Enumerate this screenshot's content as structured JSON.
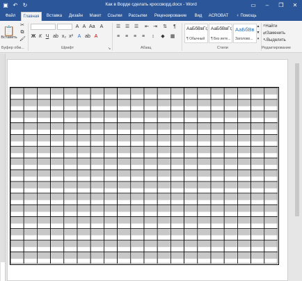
{
  "window": {
    "title": "Как в Ворде сделать кроссворд.docx - Word"
  },
  "tabs": [
    {
      "label": "Файл"
    },
    {
      "label": "Главная"
    },
    {
      "label": "Вставка"
    },
    {
      "label": "Дизайн"
    },
    {
      "label": "Макет"
    },
    {
      "label": "Ссылки"
    },
    {
      "label": "Рассылки"
    },
    {
      "label": "Рецензирование"
    },
    {
      "label": "Вид"
    },
    {
      "label": "ACROBAT"
    },
    {
      "label": "Помощь"
    }
  ],
  "ribbon": {
    "clipboard": {
      "paste_label": "Вставить",
      "group_label": "Буфер обм..."
    },
    "font": {
      "bold": "Ж",
      "italic": "К",
      "underline": "Ч",
      "group_label": "Шрифт"
    },
    "paragraph": {
      "group_label": "Абзац"
    },
    "styles": {
      "group_label": "Стили",
      "items": [
        {
          "sample": "АаБбВвГг,",
          "name": "¶ Обычный"
        },
        {
          "sample": "АаБбВвГг,",
          "name": "¶ Без инте..."
        },
        {
          "sample": "АаБбВв",
          "name": "Заголово..."
        }
      ]
    },
    "editing": {
      "find": "Найти",
      "replace": "Заменить",
      "select": "Выделить",
      "group_label": "Редактирование"
    }
  },
  "table": {
    "columns": 20,
    "rows": 15,
    "shaded_color": "#c8c8c8"
  },
  "colors": {
    "accent": "#2b579a",
    "ribbon_bg": "#f3f3f3"
  }
}
